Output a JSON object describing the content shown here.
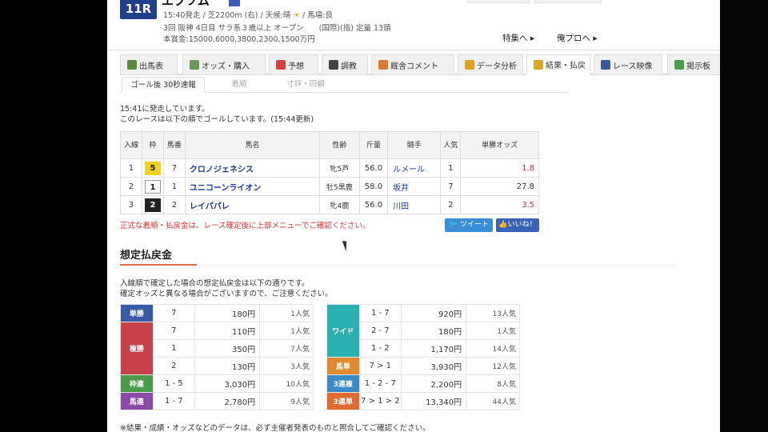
{
  "race": {
    "number": "11R",
    "name": "エプソム",
    "info1_pre": "15:40発走 / 芝2200m (右) / 天候:晴",
    "info1_post": "/ 馬場:良",
    "info2": "3回 阪神 4日目 サラ系３歳以上 オープン　　(国際)(指) 定量 13頭",
    "info3": "本賞金:15000,6000,3800,2300,1500万円"
  },
  "links": {
    "tokushu": "特集へ ▸",
    "pro": "俺プロへ ▸"
  },
  "tabs": [
    {
      "label": "出馬表",
      "icon_color": "#5a8a3a",
      "icon": "table-icon"
    },
    {
      "label": "オッズ・購入",
      "icon_color": "#6a9a5a",
      "icon": "odds-icon"
    },
    {
      "label": "予想",
      "icon_color": "#d8403a",
      "icon": "target-icon"
    },
    {
      "label": "調教",
      "icon_color": "#444444",
      "icon": "stopwatch-icon"
    },
    {
      "label": "厩舎コメント",
      "icon_color": "#e07a2a",
      "icon": "horseshoe-icon"
    },
    {
      "label": "データ分析",
      "icon_color": "#e0a020",
      "icon": "bar-chart-icon"
    },
    {
      "label": "結果・払戻",
      "icon_color": "#d8a820",
      "icon": "ticket-icon"
    },
    {
      "label": "レース映像",
      "icon_color": "#3a5a9a",
      "icon": "video-icon"
    },
    {
      "label": "掲示板",
      "icon_color": "#4aa04a",
      "icon": "chat-icon"
    }
  ],
  "subtabs": [
    "ゴール後 30秒速報",
    "着順",
    "寸評・回顧"
  ],
  "messages": {
    "line1": "15:41に発走しています。",
    "line2": "このレースは以下の順でゴールしています。(15:44更新)"
  },
  "result": {
    "headers": [
      "入線",
      "枠",
      "馬番",
      "馬名",
      "性齢",
      "斤量",
      "騎手",
      "人気",
      "単勝オッズ"
    ],
    "rows": [
      {
        "pos": "1",
        "waku": "5",
        "num": "7",
        "name": "クロノジェネシス",
        "sexage": "牝5芦",
        "weight": "56.0",
        "jockey": "ルメール",
        "pop": "1",
        "odds": "1.8"
      },
      {
        "pos": "2",
        "waku": "1",
        "num": "1",
        "name": "ユニコーンライオン",
        "sexage": "牡5黒鹿",
        "weight": "58.0",
        "jockey": "坂井",
        "pop": "7",
        "odds": "27.8"
      },
      {
        "pos": "3",
        "waku": "2",
        "num": "2",
        "name": "レイパパレ",
        "sexage": "牝4鹿",
        "weight": "56.0",
        "jockey": "川田",
        "pop": "2",
        "odds": "3.5"
      }
    ]
  },
  "notice": "正式な着順・払戻金は、レース確定後に上部メニューでご確認ください。",
  "share": {
    "tweet": "ツイート",
    "like": "いいね！"
  },
  "payout": {
    "title": "想定払戻金",
    "desc1": "入線順で確定した場合の想定払戻金は以下の通りです。",
    "desc2": "確定オッズと異なる場合がございますので、ご注意ください。",
    "left": [
      {
        "label": "単勝",
        "color": "#3a5aa8",
        "rows": [
          {
            "n": "7",
            "amt": "180円",
            "pop": "1人気"
          }
        ]
      },
      {
        "label": "複勝",
        "color": "#c8404a",
        "rows": [
          {
            "n": "7",
            "amt": "110円",
            "pop": "1人気"
          },
          {
            "n": "1",
            "amt": "350円",
            "pop": "7人気"
          },
          {
            "n": "2",
            "amt": "130円",
            "pop": "3人気"
          }
        ]
      },
      {
        "label": "枠連",
        "color": "#4a9a4a",
        "rows": [
          {
            "n": "1 - 5",
            "amt": "3,030円",
            "pop": "10人気"
          }
        ]
      },
      {
        "label": "馬連",
        "color": "#8a4aa8",
        "rows": [
          {
            "n": "1 - 7",
            "amt": "2,780円",
            "pop": "9人気"
          }
        ]
      }
    ],
    "right": [
      {
        "label": "ワイド",
        "color": "#2ab0b0",
        "rows": [
          {
            "n": "1 - 7",
            "amt": "920円",
            "pop": "13人気"
          },
          {
            "n": "2 - 7",
            "amt": "180円",
            "pop": "1人気"
          },
          {
            "n": "1 - 2",
            "amt": "1,170円",
            "pop": "14人気"
          }
        ]
      },
      {
        "label": "馬単",
        "color": "#e08a30",
        "rows": [
          {
            "n": "7 > 1",
            "amt": "3,930円",
            "pop": "12人気"
          }
        ]
      },
      {
        "label": "3連複",
        "color": "#3a8ac8",
        "rows": [
          {
            "n": "1 - 2 - 7",
            "amt": "2,200円",
            "pop": "8人気"
          }
        ]
      },
      {
        "label": "3連単",
        "color": "#e06a30",
        "rows": [
          {
            "n": "7 > 1 > 2",
            "amt": "13,340円",
            "pop": "44人気"
          }
        ]
      }
    ]
  },
  "footnote": "※結果・成績・オッズなどのデータは、必ず主催者発表のものと照合してご確認ください。",
  "waku_colors": {
    "1": "#ffffff",
    "2": "#222222",
    "5": "#f0d020"
  }
}
